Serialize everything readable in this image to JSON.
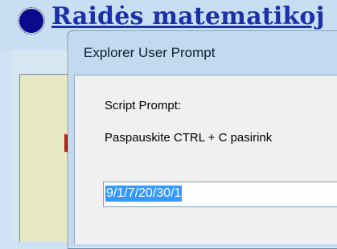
{
  "background_page": {
    "title": "Raidės matematikoj"
  },
  "dialog": {
    "title": "Explorer User Prompt",
    "label": "Script Prompt:",
    "message": "Paspauskite CTRL + C pasirink",
    "input_value": "9/1/7/20/30/1"
  },
  "colors": {
    "selection": "#3399ff",
    "title_link": "#1b2fa8",
    "bullet": "#0a0a8c"
  }
}
